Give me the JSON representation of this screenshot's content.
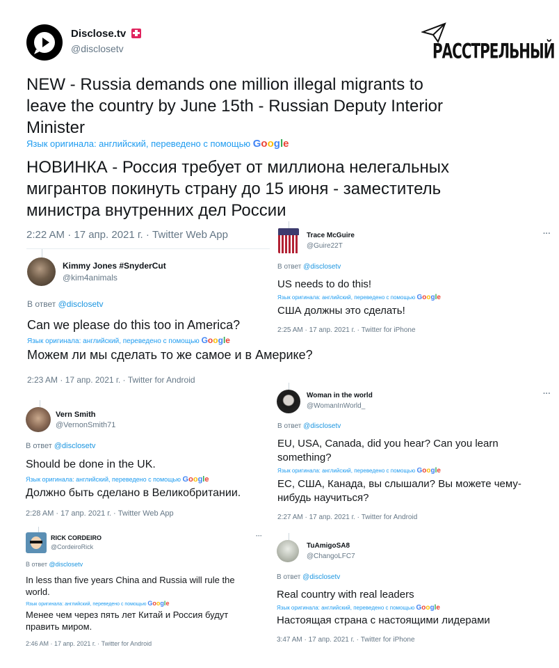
{
  "main": {
    "name": "Disclose.tv",
    "badge": "🚨",
    "handle": "@disclosetv",
    "text": "NEW - Russia demands one million illegal migrants to leave the country by June 15th - Russian Deputy Interior Minister",
    "translated_note": "Язык оригинала: английский, переведено с помощью",
    "translation": "НОВИНКА - Россия требует от миллиона нелегальных мигрантов покинуть страну до 15 июня - заместитель министра внутренних дел России",
    "meta": "2:22 AM · 17 апр. 2021 г. · Twitter Web App"
  },
  "watermark": "РАССТРЕЛЬНЫЙ",
  "google": "Google",
  "google_colors": [
    "#4285f4",
    "#ea4335",
    "#fbbc05",
    "#4285f4",
    "#34a853",
    "#ea4335"
  ],
  "reply_prefix": "В ответ",
  "replies": {
    "kimmy": {
      "name": "Kimmy Jones #SnyderCut",
      "handle": "@kim4animals",
      "reply_to": "@disclosetv",
      "text": "Can we please do this too in America?",
      "note": "Язык оригинала: английский, переведено с помощью",
      "translation": "Можем ли мы сделать то же самое и в Америке?",
      "meta": "2:23 AM · 17 апр. 2021 г. · Twitter for Android"
    },
    "trace": {
      "name": "Trace McGuire",
      "handle": "@Guire22T",
      "reply_to": "@disclosetv",
      "text": "US needs to do this!",
      "note": "Язык оригинала: английский, переведено с помощью",
      "translation": "США должны это сделать!",
      "meta": "2:25 AM · 17 апр. 2021 г. · Twitter for iPhone",
      "menu": "···"
    },
    "vern": {
      "name": "Vern Smith",
      "handle": "@VernonSmith71",
      "reply_to": "@disclosetv",
      "text": "Should be done in the UK.",
      "note": "Язык оригинала: английский, переведено с помощью",
      "translation": "Должно быть сделано в Великобритании.",
      "meta": "2:28 AM · 17 апр. 2021 г. · Twitter Web App"
    },
    "woman": {
      "name": "Woman in the world",
      "handle": "@WomanInWorld_",
      "reply_to": "@disclosetv",
      "text1": "EU, USA, Canada, did you hear? Can you learn",
      "text2": "something?",
      "note": "Язык оригинала: английский, переведено с помощью",
      "translation1": "ЕС, США, Канада, вы слышали? Вы можете чему-",
      "translation2": "нибудь научиться?",
      "meta": "2:27 AM · 17 апр. 2021 г. · Twitter for Android",
      "menu": "···"
    },
    "rick": {
      "name": "RICK CORDEIRO",
      "handle": "@CordeiroRick",
      "reply_to": "@disclosetv",
      "text1": "In less than five years China and Russia will rule the",
      "text2": "world.",
      "note": "Язык оригинала: английский, переведено с помощью",
      "translation1": "Менее чем через пять лет Китай и Россия будут",
      "translation2": "править миром.",
      "meta": "2:46 AM · 17 апр. 2021 г. · Twitter for Android",
      "menu": "···"
    },
    "tuamigo": {
      "name": "TuAmigoSA8",
      "handle": "@ChangoLFC7",
      "reply_to": "@disclosetv",
      "text": "Real country with real leaders",
      "note": "Язык оригинала: английский, переведено с помощью",
      "translation": "Настоящая страна с настоящими лидерами",
      "meta": "3:47 AM · 17 апр. 2021 г. · Twitter for iPhone"
    }
  }
}
